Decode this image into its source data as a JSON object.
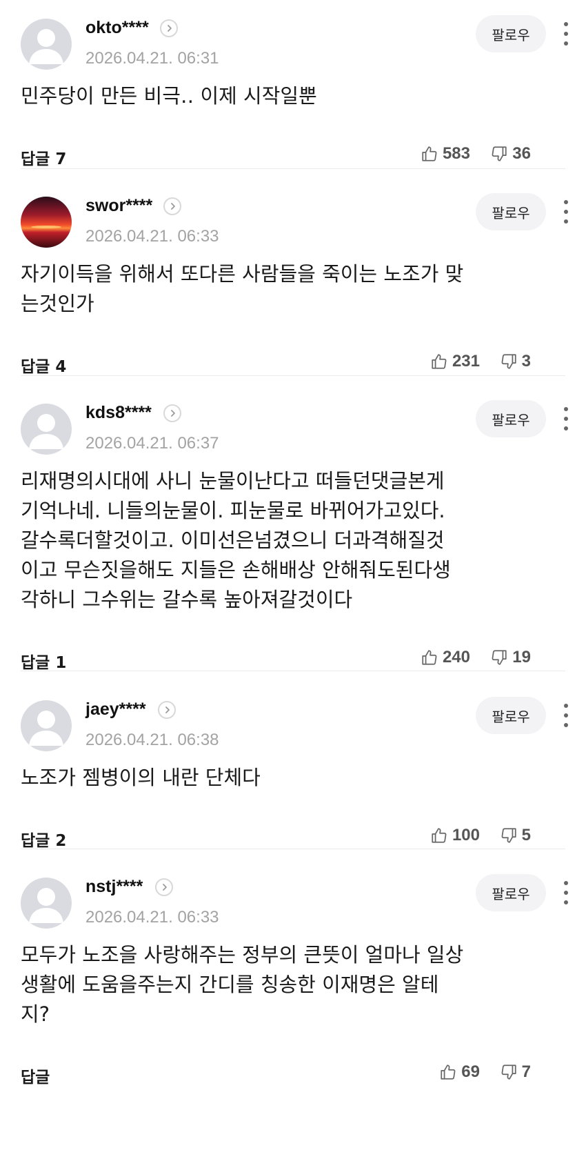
{
  "comments": [
    {
      "username": "okto****",
      "timestamp": "2026.04.21. 06:31",
      "follow_label": "팔로우",
      "lines": [
        "민주당이 만든 비극‥ 이제 시작일뿐"
      ],
      "reply_label": "답글 7",
      "likes": "583",
      "dislikes": "36",
      "avatar": "default"
    },
    {
      "username": "swor****",
      "timestamp": "2026.04.21. 06:33",
      "follow_label": "팔로우",
      "lines": [
        "자기이득을 위해서 또다른 사람들을 죽이는 노조가 맞",
        "는것인가"
      ],
      "reply_label": "답글 4",
      "likes": "231",
      "dislikes": "3",
      "avatar": "sunset"
    },
    {
      "username": "kds8****",
      "timestamp": "2026.04.21. 06:37",
      "follow_label": "팔로우",
      "lines": [
        "리재명의시대에 사니 눈물이난다고 떠들던댓글본게",
        "기억나네. 니들의눈물이. 피눈물로 바뀌어가고있다.",
        "갈수록더할것이고. 이미선은넘겼으니 더과격해질것",
        "이고 무슨짓을해도 지들은 손해배상 안해줘도된다생",
        "각하니 그수위는 갈수록 높아져갈것이다"
      ],
      "reply_label": "답글 1",
      "likes": "240",
      "dislikes": "19",
      "avatar": "default"
    },
    {
      "username": "jaey****",
      "timestamp": "2026.04.21. 06:38",
      "follow_label": "팔로우",
      "lines": [
        "노조가 젬병이의 내란 단체다"
      ],
      "reply_label": "답글 2",
      "likes": "100",
      "dislikes": "5",
      "avatar": "default"
    },
    {
      "username": "nstj****",
      "timestamp": "2026.04.21. 06:33",
      "follow_label": "팔로우",
      "lines": [
        "모두가 노조을 사랑해주는 정부의 큰뜻이 얼마나 일상",
        "생활에 도움을주는지 간디를 칭송한 이재명은 알테",
        "지?"
      ],
      "reply_label": "답글",
      "likes": "69",
      "dislikes": "7",
      "avatar": "default"
    }
  ],
  "icons": {
    "profile_arrow": "chevron-right-icon",
    "more": "more-vertical-icon",
    "like": "thumbs-up-icon",
    "dislike": "thumbs-down-icon"
  },
  "colors": {
    "text": "#1a1a1a",
    "timestamp": "#a3a3a3",
    "follow_bg": "#f3f3f5",
    "avatar_bg": "#d9dbe0",
    "divider": "#ebebeb"
  }
}
